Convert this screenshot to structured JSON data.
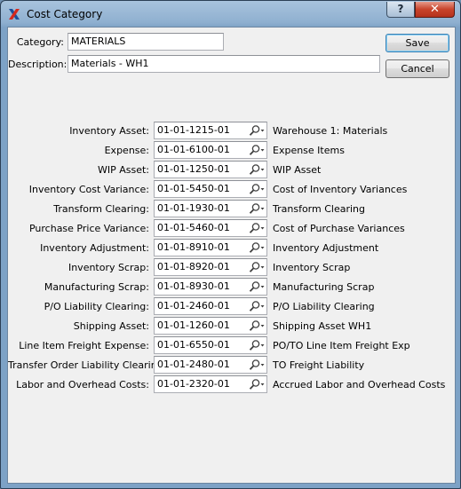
{
  "window": {
    "title": "Cost Category",
    "help_label": "?",
    "close_label": "✕"
  },
  "header": {
    "category_label": "Category:",
    "category_value": "MATERIALS",
    "description_label": "Description:",
    "description_value": "Materials - WH1"
  },
  "buttons": {
    "save": "Save",
    "cancel": "Cancel"
  },
  "accounts": [
    {
      "label": "Inventory Asset:",
      "number": "01-01-1215-01",
      "description": "Warehouse 1: Materials"
    },
    {
      "label": "Expense:",
      "number": "01-01-6100-01",
      "description": "Expense Items"
    },
    {
      "label": "WIP Asset:",
      "number": "01-01-1250-01",
      "description": "WIP Asset"
    },
    {
      "label": "Inventory Cost Variance:",
      "number": "01-01-5450-01",
      "description": "Cost of Inventory Variances"
    },
    {
      "label": "Transform Clearing:",
      "number": "01-01-1930-01",
      "description": "Transform Clearing"
    },
    {
      "label": "Purchase Price Variance:",
      "number": "01-01-5460-01",
      "description": "Cost of Purchase Variances"
    },
    {
      "label": "Inventory Adjustment:",
      "number": "01-01-8910-01",
      "description": "Inventory Adjustment"
    },
    {
      "label": "Inventory Scrap:",
      "number": "01-01-8920-01",
      "description": "Inventory Scrap"
    },
    {
      "label": "Manufacturing Scrap:",
      "number": "01-01-8930-01",
      "description": "Manufacturing Scrap"
    },
    {
      "label": "P/O Liability Clearing:",
      "number": "01-01-2460-01",
      "description": "P/O Liability Clearing"
    },
    {
      "label": "Shipping Asset:",
      "number": "01-01-1260-01",
      "description": "Shipping Asset WH1"
    },
    {
      "label": "Line Item Freight Expense:",
      "number": "01-01-6550-01",
      "description": "PO/TO Line Item Freight Exp"
    },
    {
      "label": "Transfer Order Liability Clearing:",
      "number": "01-01-2480-01",
      "description": "TO Freight Liability"
    },
    {
      "label": "Labor and Overhead Costs:",
      "number": "01-01-2320-01",
      "description": "Accrued Labor and Overhead Costs"
    }
  ],
  "icons": {
    "app": "xtuple-x-icon",
    "lookup": "magnifier-dropdown-icon"
  }
}
